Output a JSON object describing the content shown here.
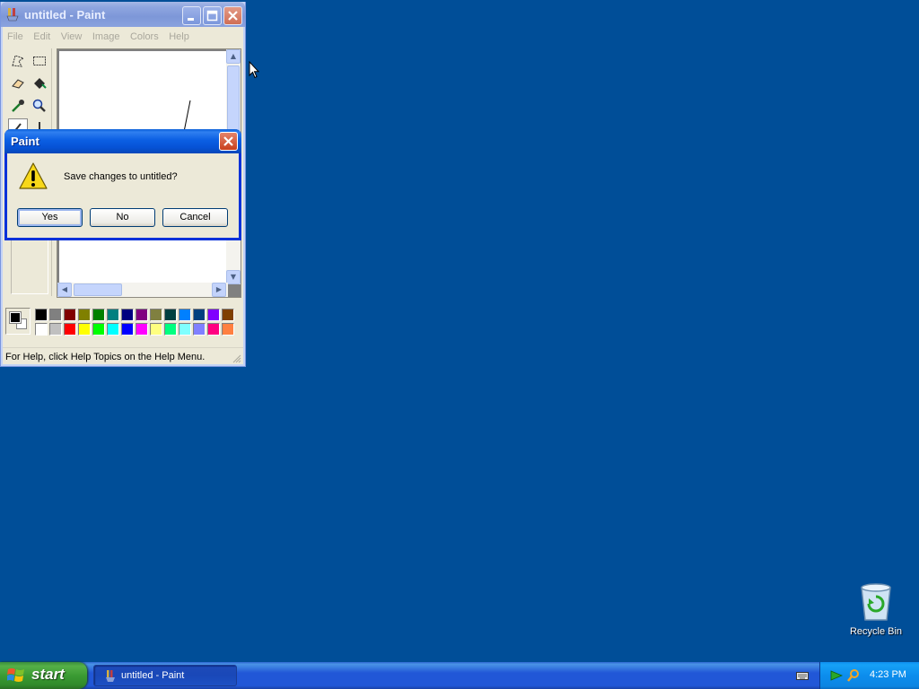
{
  "paint_window": {
    "title": "untitled - Paint",
    "menu": [
      "File",
      "Edit",
      "View",
      "Image",
      "Colors",
      "Help"
    ],
    "tools": [
      "free-form-select",
      "select",
      "eraser",
      "fill-with-color",
      "pick-color",
      "magnifier",
      "pencil",
      "brush"
    ],
    "palette": {
      "foreground": "#000000",
      "background": "#ffffff",
      "colors_row1": [
        "#000000",
        "#808080",
        "#800000",
        "#808000",
        "#008000",
        "#008080",
        "#000080",
        "#800080",
        "#808040",
        "#004040",
        "#0080ff",
        "#004080",
        "#8000ff",
        "#804000"
      ],
      "colors_row2": [
        "#ffffff",
        "#c0c0c0",
        "#ff0000",
        "#ffff00",
        "#00ff00",
        "#00ffff",
        "#0000ff",
        "#ff00ff",
        "#ffff80",
        "#00ff80",
        "#80ffff",
        "#8080ff",
        "#ff0080",
        "#ff8040"
      ]
    },
    "status_text": "For Help, click Help Topics on the Help Menu."
  },
  "dialog": {
    "title": "Paint",
    "message": "Save changes to untitled?",
    "buttons": {
      "yes": "Yes",
      "no": "No",
      "cancel": "Cancel"
    }
  },
  "desktop": {
    "recycle_bin_label": "Recycle Bin",
    "background_color": "#004e98"
  },
  "taskbar": {
    "start_label": "start",
    "task_label": "untitled - Paint",
    "clock": "4:23 PM"
  }
}
